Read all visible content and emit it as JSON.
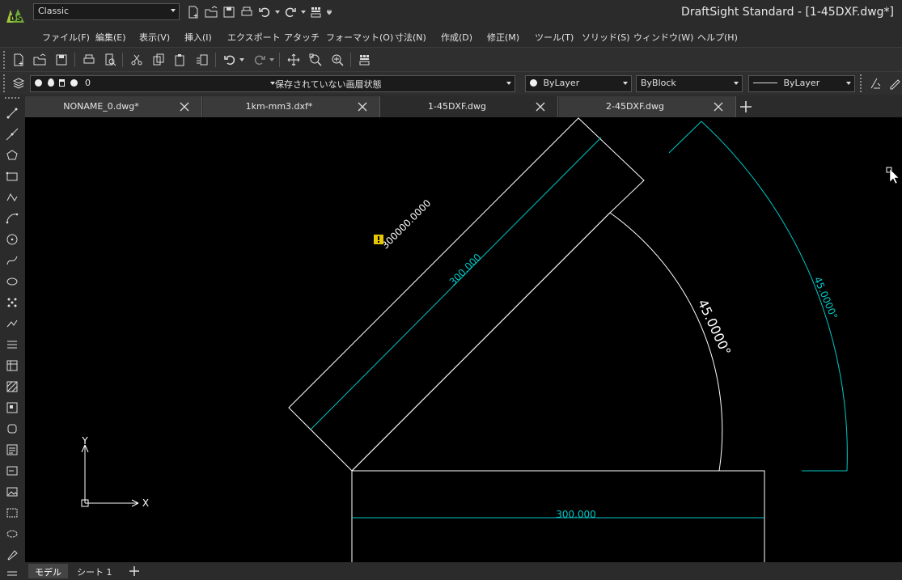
{
  "window": {
    "title": "DraftSight Standard - [1-45DXF.dwg*]",
    "workspace": "Classic"
  },
  "qat_icons": [
    "new-file-icon",
    "open-folder-icon",
    "save-icon",
    "print-icon",
    "undo-icon",
    "redo-icon",
    "customize-icon"
  ],
  "menu": {
    "items": [
      "ファイル(F)",
      "編集(E)",
      "表示(V)",
      "挿入(I)",
      "エクスポート",
      "アタッチ",
      "フォーマット(O)",
      "寸法(N)",
      "作成(D)",
      "修正(M)",
      "ツール(T)",
      "ソリッド(S)",
      "ウィンドウ(W)",
      "ヘルプ(H)"
    ]
  },
  "layer_bar": {
    "layer_name": "0",
    "layer_state": "保存されていない画層状態",
    "color": "ByLayer",
    "linetype": "ByBlock",
    "lineweight": "ByLayer"
  },
  "tabs": [
    {
      "label": "NONAME_0.dwg*"
    },
    {
      "label": "1km-mm3.dxf*"
    },
    {
      "label": "1-45DXF.dwg"
    },
    {
      "label": "2-45DXF.dwg"
    }
  ],
  "drawing": {
    "dim_top_rect": "300.000",
    "dim_bottom_rect": "300.000",
    "dim_outer_long": "300000.0000",
    "dim_inner_angle": "45.0000°",
    "dim_outer_angle": "45.0000°",
    "axis_y": "Y",
    "axis_x": "X",
    "colors": {
      "geometry": "#ffffff",
      "dimension": "#00c8c8",
      "warning": "#e8c800"
    }
  },
  "layouts": {
    "model": "モデル",
    "sheet1": "シート 1"
  }
}
